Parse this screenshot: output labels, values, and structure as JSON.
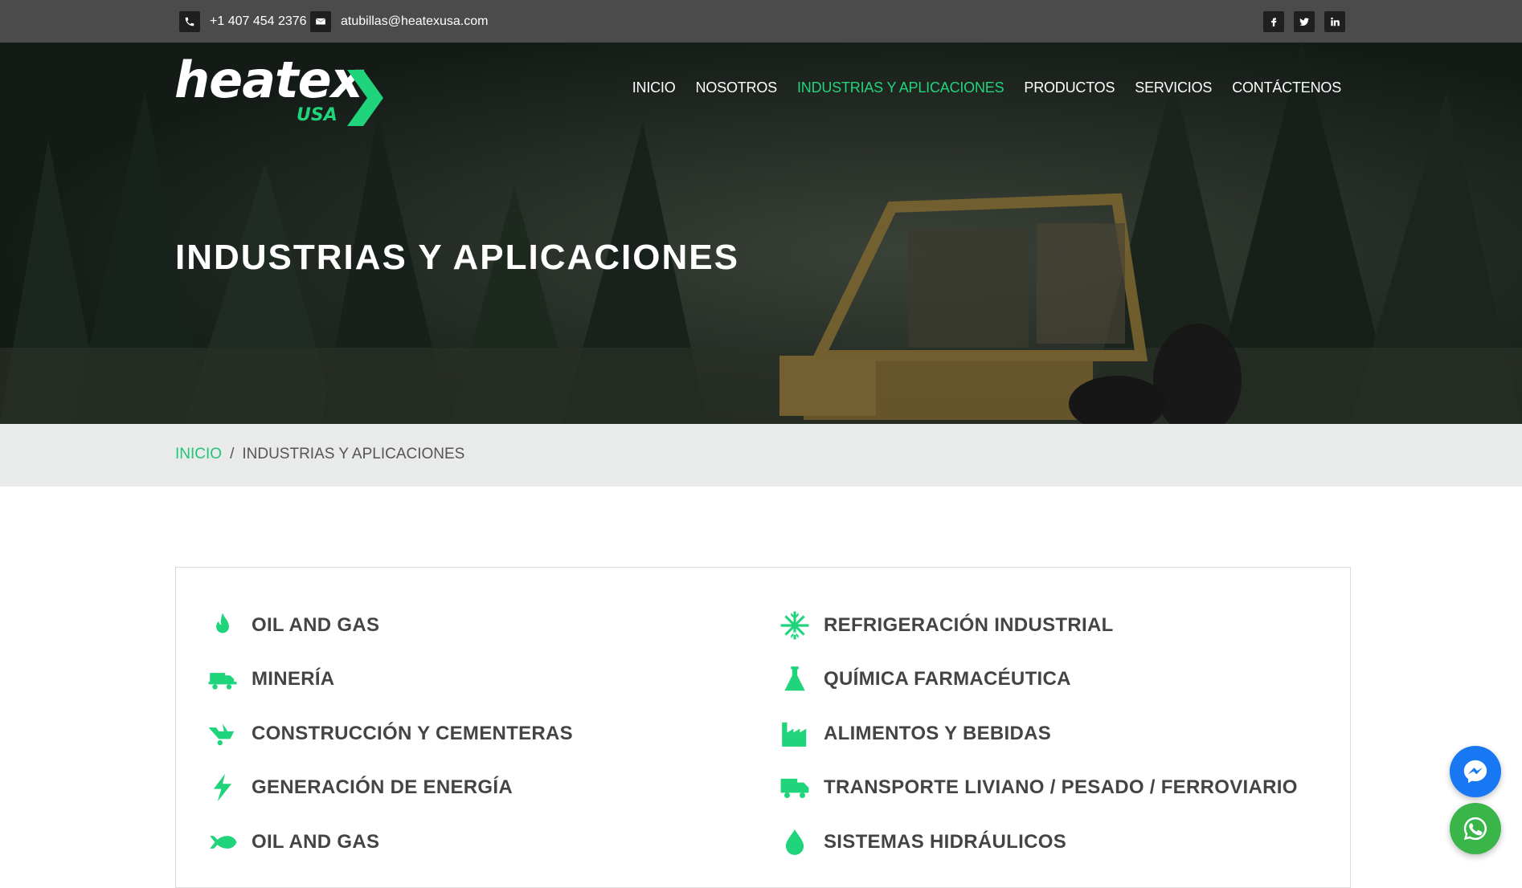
{
  "topbar": {
    "phone": "+1 407 454 2376",
    "email": "atubillas@heatexusa.com",
    "social": [
      "facebook-icon",
      "twitter-icon",
      "linkedin-icon"
    ]
  },
  "brand": {
    "name": "heatex",
    "sub": "USA",
    "accent": "#1fd47a"
  },
  "nav": {
    "items": [
      {
        "label": "INICIO"
      },
      {
        "label": "NOSOTROS"
      },
      {
        "label": "INDUSTRIAS Y APLICACIONES",
        "active": true
      },
      {
        "label": "PRODUCTOS"
      },
      {
        "label": "SERVICIOS"
      },
      {
        "label": "CONTÁCTENOS"
      }
    ]
  },
  "hero": {
    "title": "INDUSTRIAS Y APLICACIONES"
  },
  "breadcrumb": {
    "home": "INICIO",
    "separator": "/",
    "current": "INDUSTRIAS Y APLICACIONES"
  },
  "industries": {
    "left": [
      {
        "label": "OIL AND GAS",
        "icon": "flame-icon"
      },
      {
        "label": "MINERÍA",
        "icon": "mining-truck-icon"
      },
      {
        "label": "CONSTRUCCIÓN Y CEMENTERAS",
        "icon": "wheelbarrow-icon"
      },
      {
        "label": "GENERACIÓN DE ENERGÍA",
        "icon": "lightning-icon"
      },
      {
        "label": "OIL AND GAS",
        "icon": "fish-icon"
      }
    ],
    "right": [
      {
        "label": "REFRIGERACIÓN INDUSTRIAL",
        "icon": "snowflake-icon"
      },
      {
        "label": "QUÍMICA FARMACÉUTICA",
        "icon": "flask-icon"
      },
      {
        "label": "ALIMENTOS Y BEBIDAS",
        "icon": "factory-icon"
      },
      {
        "label": "TRANSPORTE LIVIANO / PESADO / FERROVIARIO",
        "icon": "truck-icon"
      },
      {
        "label": "SISTEMAS HIDRÁULICOS",
        "icon": "drop-icon"
      }
    ]
  },
  "floating": {
    "messenger": "messenger-icon",
    "whatsapp": "whatsapp-icon"
  }
}
